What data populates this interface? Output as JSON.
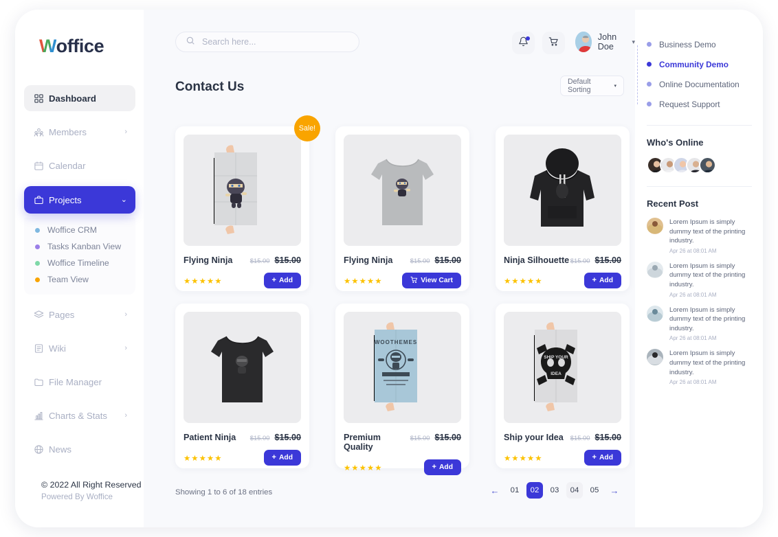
{
  "brand": {
    "logo_w": "W",
    "logo_rest": "office"
  },
  "sidebar": {
    "items": [
      {
        "label": "Dashboard",
        "icon": "grid-icon",
        "chevron": "",
        "state": "active-soft"
      },
      {
        "label": "Members",
        "icon": "members-icon",
        "chevron": "›",
        "state": ""
      },
      {
        "label": "Calendar",
        "icon": "calendar-icon",
        "chevron": "",
        "state": ""
      },
      {
        "label": "Projects",
        "icon": "briefcase-icon",
        "chevron": "⌄",
        "state": "active-blue"
      },
      {
        "label": "Pages",
        "icon": "layers-icon",
        "chevron": "›",
        "state": ""
      },
      {
        "label": "Wiki",
        "icon": "book-icon",
        "chevron": "›",
        "state": ""
      },
      {
        "label": "File Manager",
        "icon": "folder-icon",
        "chevron": "",
        "state": ""
      },
      {
        "label": "Charts & Stats",
        "icon": "bar-chart-icon",
        "chevron": "›",
        "state": ""
      },
      {
        "label": "News",
        "icon": "globe-icon",
        "chevron": "",
        "state": ""
      }
    ],
    "subitems": [
      {
        "label": "Woffice CRM",
        "color": "#7fb8e0"
      },
      {
        "label": "Tasks Kanban View",
        "color": "#9b7fe8"
      },
      {
        "label": "Woffice Timeline",
        "color": "#7fd8a8"
      },
      {
        "label": "Team View",
        "color": "#f9a400"
      }
    ]
  },
  "footer": {
    "copyright": "© 2022 All Right Reserved",
    "powered": "Powered By Woffice"
  },
  "header": {
    "search_placeholder": "Search here...",
    "search_value": "",
    "bell_icon": "bell-icon",
    "cart_icon": "cart-icon",
    "username": "John Doe",
    "caret": "▾"
  },
  "page": {
    "title": "Contact Us",
    "sorting_label": "Default Sorting",
    "sorting_caret": "▾"
  },
  "products": [
    {
      "name": "Flying Ninja",
      "old_price": "$15.00",
      "new_price": "$15.00",
      "stars": "★★★★★",
      "button": "Add",
      "button_icon": "plus-icon",
      "sale": "Sale!",
      "image": "poster-ninja"
    },
    {
      "name": "Flying Ninja",
      "old_price": "$15.00",
      "new_price": "$15.00",
      "stars": "★★★★★",
      "button": "View Cart",
      "button_icon": "cart-icon",
      "sale": "",
      "image": "tshirt-gray"
    },
    {
      "name": "Ninja Silhouette",
      "old_price": "$15.00",
      "new_price": "$15.00",
      "stars": "★★★★★",
      "button": "Add",
      "button_icon": "plus-icon",
      "sale": "",
      "image": "hoodie-black"
    },
    {
      "name": "Patient Ninja",
      "old_price": "$15.00",
      "new_price": "$15.00",
      "stars": "★★★★★",
      "button": "Add",
      "button_icon": "plus-icon",
      "sale": "",
      "image": "tshirt-black"
    },
    {
      "name": "Premium Quality",
      "old_price": "$15.00",
      "new_price": "$15.00",
      "stars": "★★★★★",
      "button": "Add",
      "button_icon": "plus-icon",
      "sale": "",
      "image": "poster-blue"
    },
    {
      "name": "Ship your Idea",
      "old_price": "$15.00",
      "new_price": "$15.00",
      "stars": "★★★★★",
      "button": "Add",
      "button_icon": "plus-icon",
      "sale": "",
      "image": "poster-skull"
    }
  ],
  "pagination": {
    "showing": "Showing 1 to 6 of 18 entries",
    "prev": "←",
    "next": "→",
    "pages": [
      {
        "label": "01",
        "state": ""
      },
      {
        "label": "02",
        "state": "active"
      },
      {
        "label": "03",
        "state": ""
      },
      {
        "label": "04",
        "state": "soft"
      },
      {
        "label": "05",
        "state": ""
      }
    ]
  },
  "rightpanel": {
    "links": [
      {
        "label": "Business Demo",
        "state": ""
      },
      {
        "label": "Community Demo",
        "state": "on"
      },
      {
        "label": "Online Documentation",
        "state": ""
      },
      {
        "label": "Request Support",
        "state": ""
      }
    ],
    "online_title": "Who's Online",
    "online_count": 5,
    "recent_title": "Recent Post",
    "posts": [
      {
        "text": "Lorem Ipsum is simply dummy text of the printing industry.",
        "time": "Apr 26 at 08:01 AM"
      },
      {
        "text": "Lorem Ipsum is simply dummy text of the printing industry.",
        "time": "Apr 26 at 08:01 AM"
      },
      {
        "text": "Lorem Ipsum is simply dummy text of the printing industry.",
        "time": "Apr 26 at 08:01 AM"
      },
      {
        "text": "Lorem Ipsum is simply dummy text of the printing industry.",
        "time": "Apr 26 at 08:01 AM"
      }
    ]
  },
  "colors": {
    "accent": "#3b38d8",
    "sale": "#f9a400",
    "star": "#fcc201",
    "text": "#2b3445",
    "muted": "#a9afc3"
  }
}
